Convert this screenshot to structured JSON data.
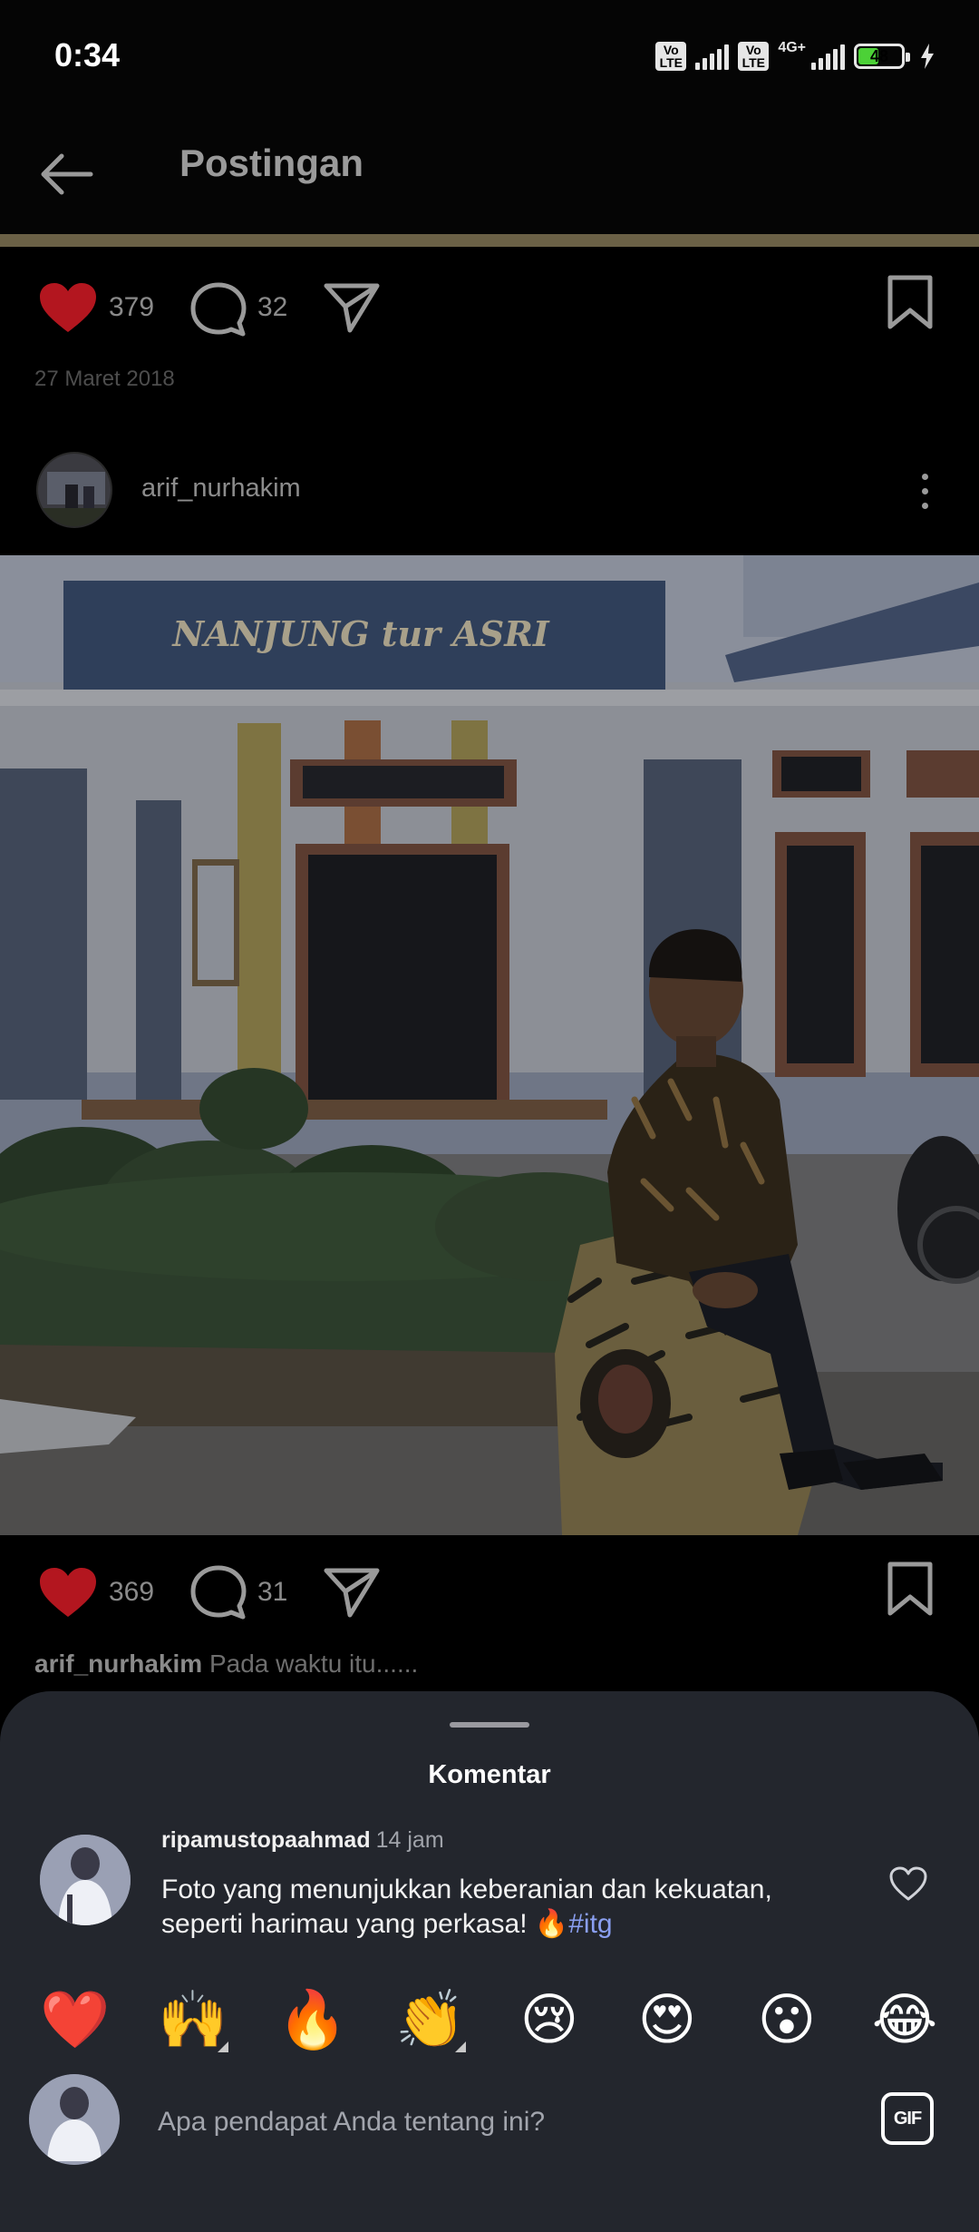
{
  "status_bar": {
    "time": "0:34",
    "volte_label": "Vo LTE",
    "network_label": "4G+",
    "battery_level": "48",
    "battery_percent": 48,
    "charging": true
  },
  "header": {
    "title": "Postingan",
    "back_icon": "arrow-left-icon"
  },
  "previous_post": {
    "likes": "379",
    "comments": "32",
    "date": "27 Maret 2018"
  },
  "post": {
    "username": "arif_nurhakim",
    "photo_sign_text": "NANJUNG tur ASRI",
    "likes": "369",
    "comments": "31",
    "caption_user": "arif_nurhakim",
    "caption_text": "Pada waktu itu......"
  },
  "comments_sheet": {
    "title": "Komentar",
    "comment": {
      "username": "ripamustopaahmad",
      "time": "14 jam",
      "text": "Foto yang menunjukkan keberanian dan kekuatan, seperti harimau yang perkasa! 🔥",
      "hashtag": "#itg"
    },
    "quick_emojis": [
      "❤️",
      "🙌",
      "🔥",
      "👏",
      "😢",
      "😍",
      "😮",
      "😂"
    ],
    "input_placeholder": "Apa pendapat Anda tentang ini?",
    "gif_label": "GIF"
  },
  "colors": {
    "heart_red": "#b3161f",
    "sheet_bg": "#23262d",
    "hashtag": "#8a9ff0"
  }
}
